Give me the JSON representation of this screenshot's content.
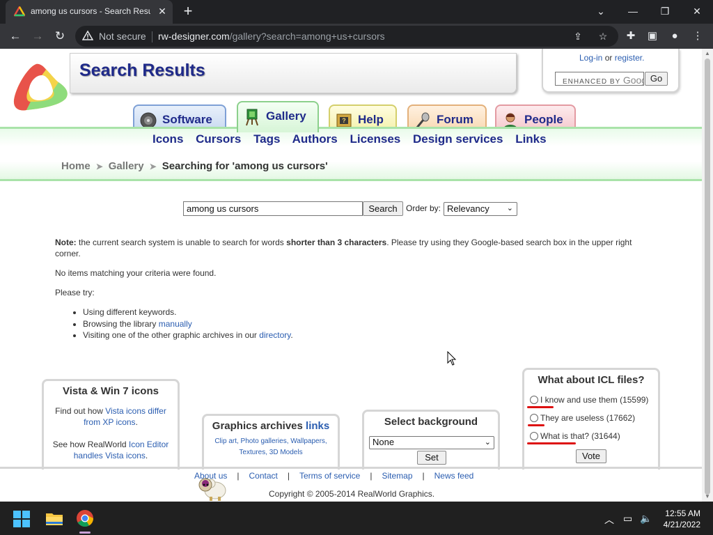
{
  "browser": {
    "tab_title": "among us cursors - Search Results - RW-Designer",
    "security_label": "Not secure",
    "url_host": "rw-designer.com",
    "url_path": "/gallery?search=among+us+cursors"
  },
  "header": {
    "page_title": "Search Results",
    "login_label": "Log-in",
    "or_label": "or",
    "register_label": "register.",
    "google_enhanced": "ENHANCED BY",
    "google_word": "Goog",
    "go_label": "Go"
  },
  "tabs": [
    {
      "label": "Software"
    },
    {
      "label": "Gallery"
    },
    {
      "label": "Help"
    },
    {
      "label": "Forum"
    },
    {
      "label": "People"
    }
  ],
  "subnav": [
    "Icons",
    "Cursors",
    "Tags",
    "Authors",
    "Licenses",
    "Design services",
    "Links"
  ],
  "breadcrumb": {
    "home": "Home",
    "gallery": "Gallery",
    "current": "Searching for 'among us cursors'"
  },
  "search": {
    "value": "among us cursors",
    "button": "Search",
    "order_label": "Order by:",
    "order_value": "Relevancy"
  },
  "content": {
    "note_label": "Note:",
    "note_text_1": " the current search system is unable to search for words ",
    "note_bold": "shorter than 3 characters",
    "note_text_2": ". Please try using they Google-based search box in the upper right corner.",
    "no_items": "No items matching your criteria were found.",
    "please_try": "Please try:",
    "try_1": "Using different keywords.",
    "try_2_text": "Browsing the library ",
    "try_2_link": "manually",
    "try_3_text": "Visiting one of the other graphic archives in our ",
    "try_3_link": "directory",
    "try_3_end": "."
  },
  "box_vista": {
    "title": "Vista & Win 7 icons",
    "p1_text": "Find out how ",
    "p1_link": "Vista icons differ from XP icons",
    "p1_end": ".",
    "p2_text": "See how RealWorld ",
    "p2_link": "Icon Editor handles Vista icons",
    "p2_end": "."
  },
  "box_archives": {
    "title": "Graphics archives ",
    "title_link": "links",
    "links": "Clip art, Photo galleries, Wallpapers, Textures, 3D Models"
  },
  "box_bg": {
    "title": "Select background",
    "select_value": "None",
    "button": "Set"
  },
  "poll": {
    "title": "What about ICL files?",
    "options": [
      "I know and use them (15599)",
      "They are useless (17662)",
      "What is that? (31644)"
    ],
    "vote": "Vote"
  },
  "footer": {
    "links": [
      "About us",
      "Contact",
      "Terms of service",
      "Sitemap",
      "News feed"
    ],
    "copyright": "Copyright © 2005-2014 RealWorld Graphics."
  },
  "taskbar": {
    "time": "12:55 AM",
    "date": "4/21/2022"
  },
  "colors": {
    "brand_blue": "#1f2a8a",
    "link_blue": "#2a5db0",
    "green_band": "#a9e3a9",
    "annotation_red": "#d11"
  }
}
